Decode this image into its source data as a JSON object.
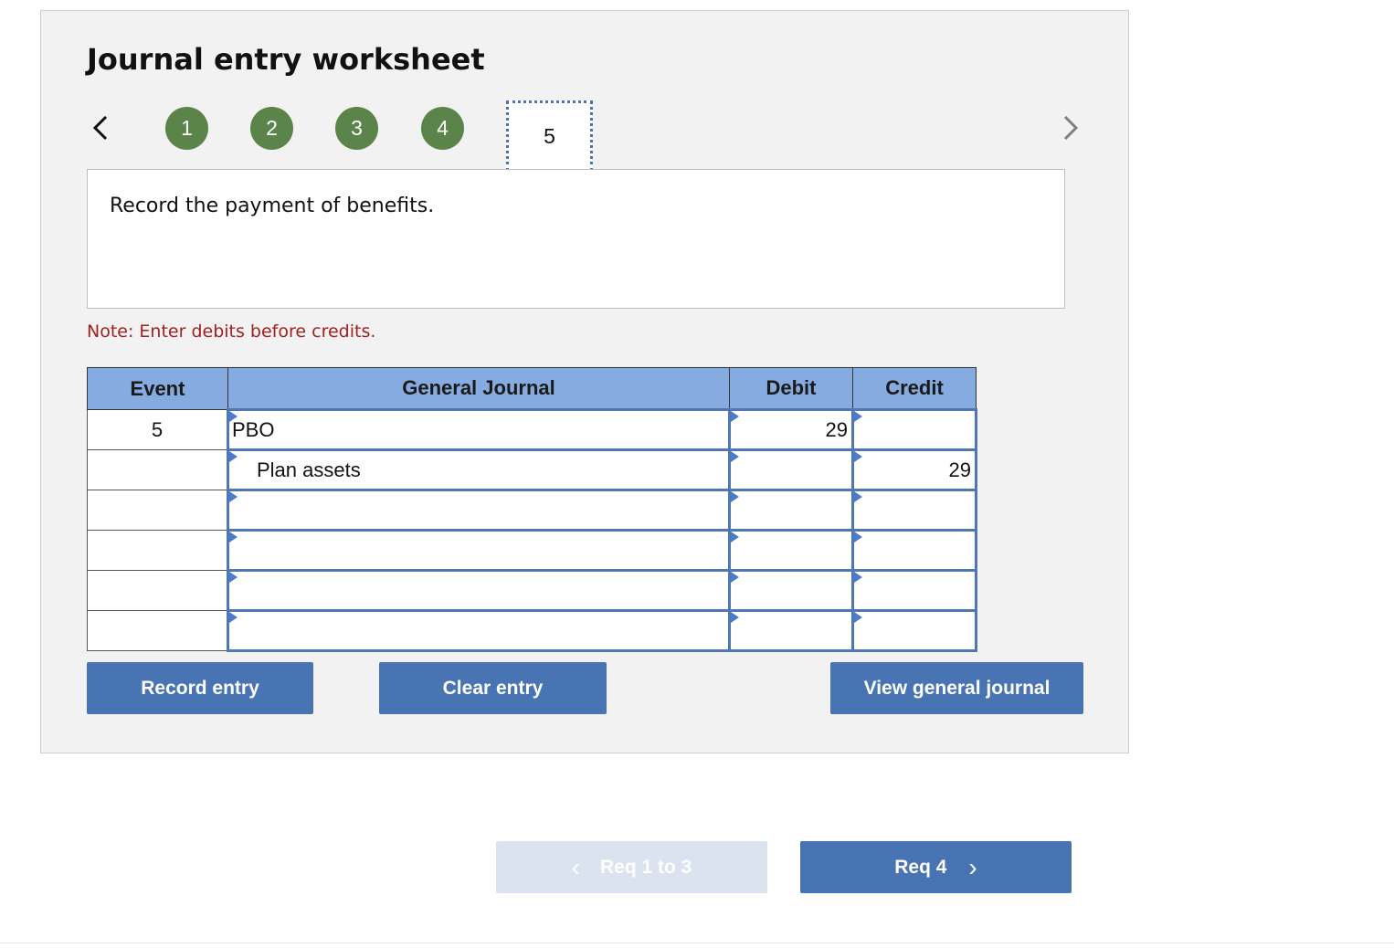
{
  "worksheet": {
    "title": "Journal entry worksheet",
    "steps": [
      {
        "label": "1",
        "state": "complete"
      },
      {
        "label": "2",
        "state": "complete"
      },
      {
        "label": "3",
        "state": "complete"
      },
      {
        "label": "4",
        "state": "complete"
      },
      {
        "label": "5",
        "state": "current"
      }
    ],
    "prev_icon": "chevron-left-icon",
    "next_icon": "chevron-right-icon",
    "prompt": "Record the payment of benefits.",
    "note": "Note: Enter debits before credits."
  },
  "journal": {
    "headers": {
      "event": "Event",
      "general_journal": "General Journal",
      "debit": "Debit",
      "credit": "Credit"
    },
    "rows": [
      {
        "event": "5",
        "account": "PBO",
        "debit": "29",
        "credit": ""
      },
      {
        "event": "",
        "account": "Plan assets",
        "debit": "",
        "credit": "29"
      },
      {
        "event": "",
        "account": "",
        "debit": "",
        "credit": ""
      },
      {
        "event": "",
        "account": "",
        "debit": "",
        "credit": ""
      },
      {
        "event": "",
        "account": "",
        "debit": "",
        "credit": ""
      },
      {
        "event": "",
        "account": "",
        "debit": "",
        "credit": ""
      }
    ]
  },
  "actions": {
    "record_entry": "Record entry",
    "clear_entry": "Clear entry",
    "view_general_journal": "View general journal"
  },
  "pager": {
    "prev_label": "Req 1 to 3",
    "next_label": "Req 4",
    "prev_icon": "‹",
    "next_icon": "›"
  },
  "colors": {
    "step_complete": "#5a8449",
    "header_bg": "#86abe0",
    "button": "#4874b4",
    "note": "#a32020"
  }
}
